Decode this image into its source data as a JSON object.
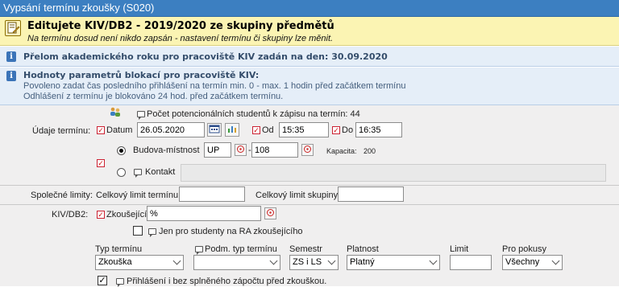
{
  "window": {
    "title": "Vypsání termínu zkoušky (S020)"
  },
  "banner": {
    "title": "Editujete KIV/DB2 - 2019/2020 ze skupiny předmětů",
    "subtitle": "Na termínu dosud není nikdo zapsán - nastavení termínu či skupiny lze měnit."
  },
  "info1": {
    "title": "Přelom akademického roku pro pracoviště KIV zadán na den: 30.09.2020"
  },
  "info2": {
    "title": "Hodnoty parametrů blokací pro pracoviště KIV:",
    "line1": "Povoleno zadat čas posledního přihlášení na termín min. 0 - max. 1 hodin před začátkem termínu",
    "line2": "Odhlášení z termínu je blokováno 24 hod. před začátkem termínu."
  },
  "form": {
    "potential_students": "Počet potencionálních studentů k zápisu na termín: 44",
    "term_label": "Údaje termínu:",
    "date_label": "Datum",
    "date_value": "26.05.2020",
    "from_label": "Od",
    "from_value": "15:35",
    "to_label": "Do",
    "to_value": "16:35",
    "building_label": "Budova-místnost",
    "building_value": "UP",
    "room_sep": "-",
    "room_value": "108",
    "capacity_label": "Kapacita:",
    "capacity_value": "200",
    "contact_label": "Kontakt",
    "contact_value": "",
    "common_limits_label": "Společné limity:",
    "total_limit_label": "Celkový limit termínu",
    "total_limit_value": "",
    "group_limit_label": "Celkový limit skupiny",
    "group_limit_value": "",
    "course_label": "KIV/DB2:",
    "examiners_label": "Zkoušející",
    "examiners_value": "%",
    "ra_only_label": "Jen pro studenty na RA zkoušejícího",
    "columns": {
      "term_type": "Typ termínu",
      "sub_term_type": "Podm. typ termínu",
      "semester": "Semestr",
      "validity": "Platnost",
      "limit": "Limit",
      "for_attempts": "Pro pokusy"
    },
    "values": {
      "term_type": "Zkouška",
      "sub_term_type": "",
      "semester": "ZS i LS",
      "validity": "Platný",
      "limit": "",
      "for_attempts": "Všechny"
    },
    "without_credit_label": "Přihlášení i bez splněného zápočtu před zkouškou."
  },
  "colors": {
    "titlebar": "#3c7fc1",
    "banner": "#fbf4b3",
    "info": "#e5eef8",
    "form": "#f0efef",
    "required": "#cc2233"
  }
}
